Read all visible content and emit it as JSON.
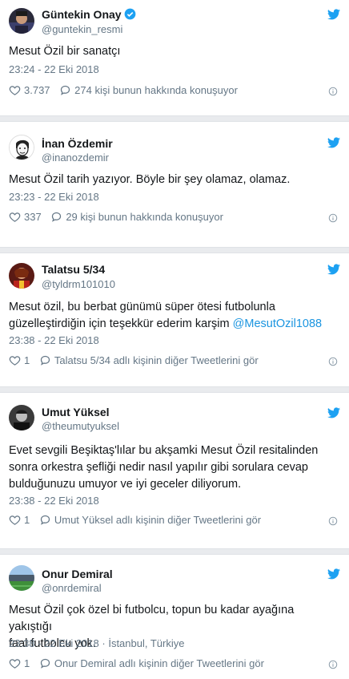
{
  "colors": {
    "accent": "#1da1f2",
    "mention": "#1b95e0",
    "muted": "#657786",
    "separator": "#e9ebee"
  },
  "tweets": [
    {
      "name": "Güntekin Onay",
      "handle": "@guntekin_resmi",
      "verified": true,
      "text": "Mesut Özil bir sanatçı",
      "timestamp": "23:24 - 22 Eki 2018",
      "likes": "3.737",
      "talk": "274 kişi bunun hakkında konuşuyor",
      "avatar_icon": "portrait-icon"
    },
    {
      "name": "İnan Özdemir",
      "handle": "@inanozdemir",
      "text": "Mesut Özil tarih yazıyor. Böyle bir şey olamaz, olamaz.",
      "timestamp": "23:23 - 22 Eki 2018",
      "likes": "337",
      "talk": "29 kişi bunun hakkında konuşuyor",
      "avatar_icon": "cartoon-face-icon"
    },
    {
      "name": "Talatsu 5/34",
      "handle": "@tyldrm101010",
      "text_line1": "Mesut özil, bu berbat günümü süper ötesi futbolunla",
      "text_line2": "güzelleştirdiğin için teşekkür ederim karşim ",
      "mention": "@MesutOzil1088",
      "timestamp": "23:38 - 22 Eki 2018",
      "likes": "1",
      "more": "Talatsu 5/34 adlı kişinin diğer Tweetlerini gör",
      "avatar_icon": "photo-avatar-icon"
    },
    {
      "name": "Umut Yüksel",
      "handle": "@theumutyuksel",
      "text_lines": [
        "Evet sevgili Beşiktaş'lılar bu akşamki Mesut Özil resitalinden",
        "sonra orkestra şefliği nedir nasıl yapılır gibi sorulara cevap",
        "bulduğunuzu umuyor ve iyi geceler diliyorum."
      ],
      "timestamp": "23:38 - 22 Eki 2018",
      "likes": "1",
      "more": "Umut Yüksel adlı kişinin diğer Tweetlerini gör",
      "avatar_icon": "bw-photo-avatar-icon"
    },
    {
      "name": "Onur Demiral",
      "handle": "@onrdemiral",
      "text_lines": [
        "Mesut Özil çok özel bi futbolcu, topun bu kadar ayağına yakıştığı",
        "faal futbolcu yok."
      ],
      "timestamp": "23:38 - 22 Eki 2018",
      "location": "İstanbul, Türkiye",
      "likes": "1",
      "more": "Onur Demiral adlı kişinin diğer Tweetlerini gör",
      "avatar_icon": "stadium-avatar-icon"
    }
  ]
}
